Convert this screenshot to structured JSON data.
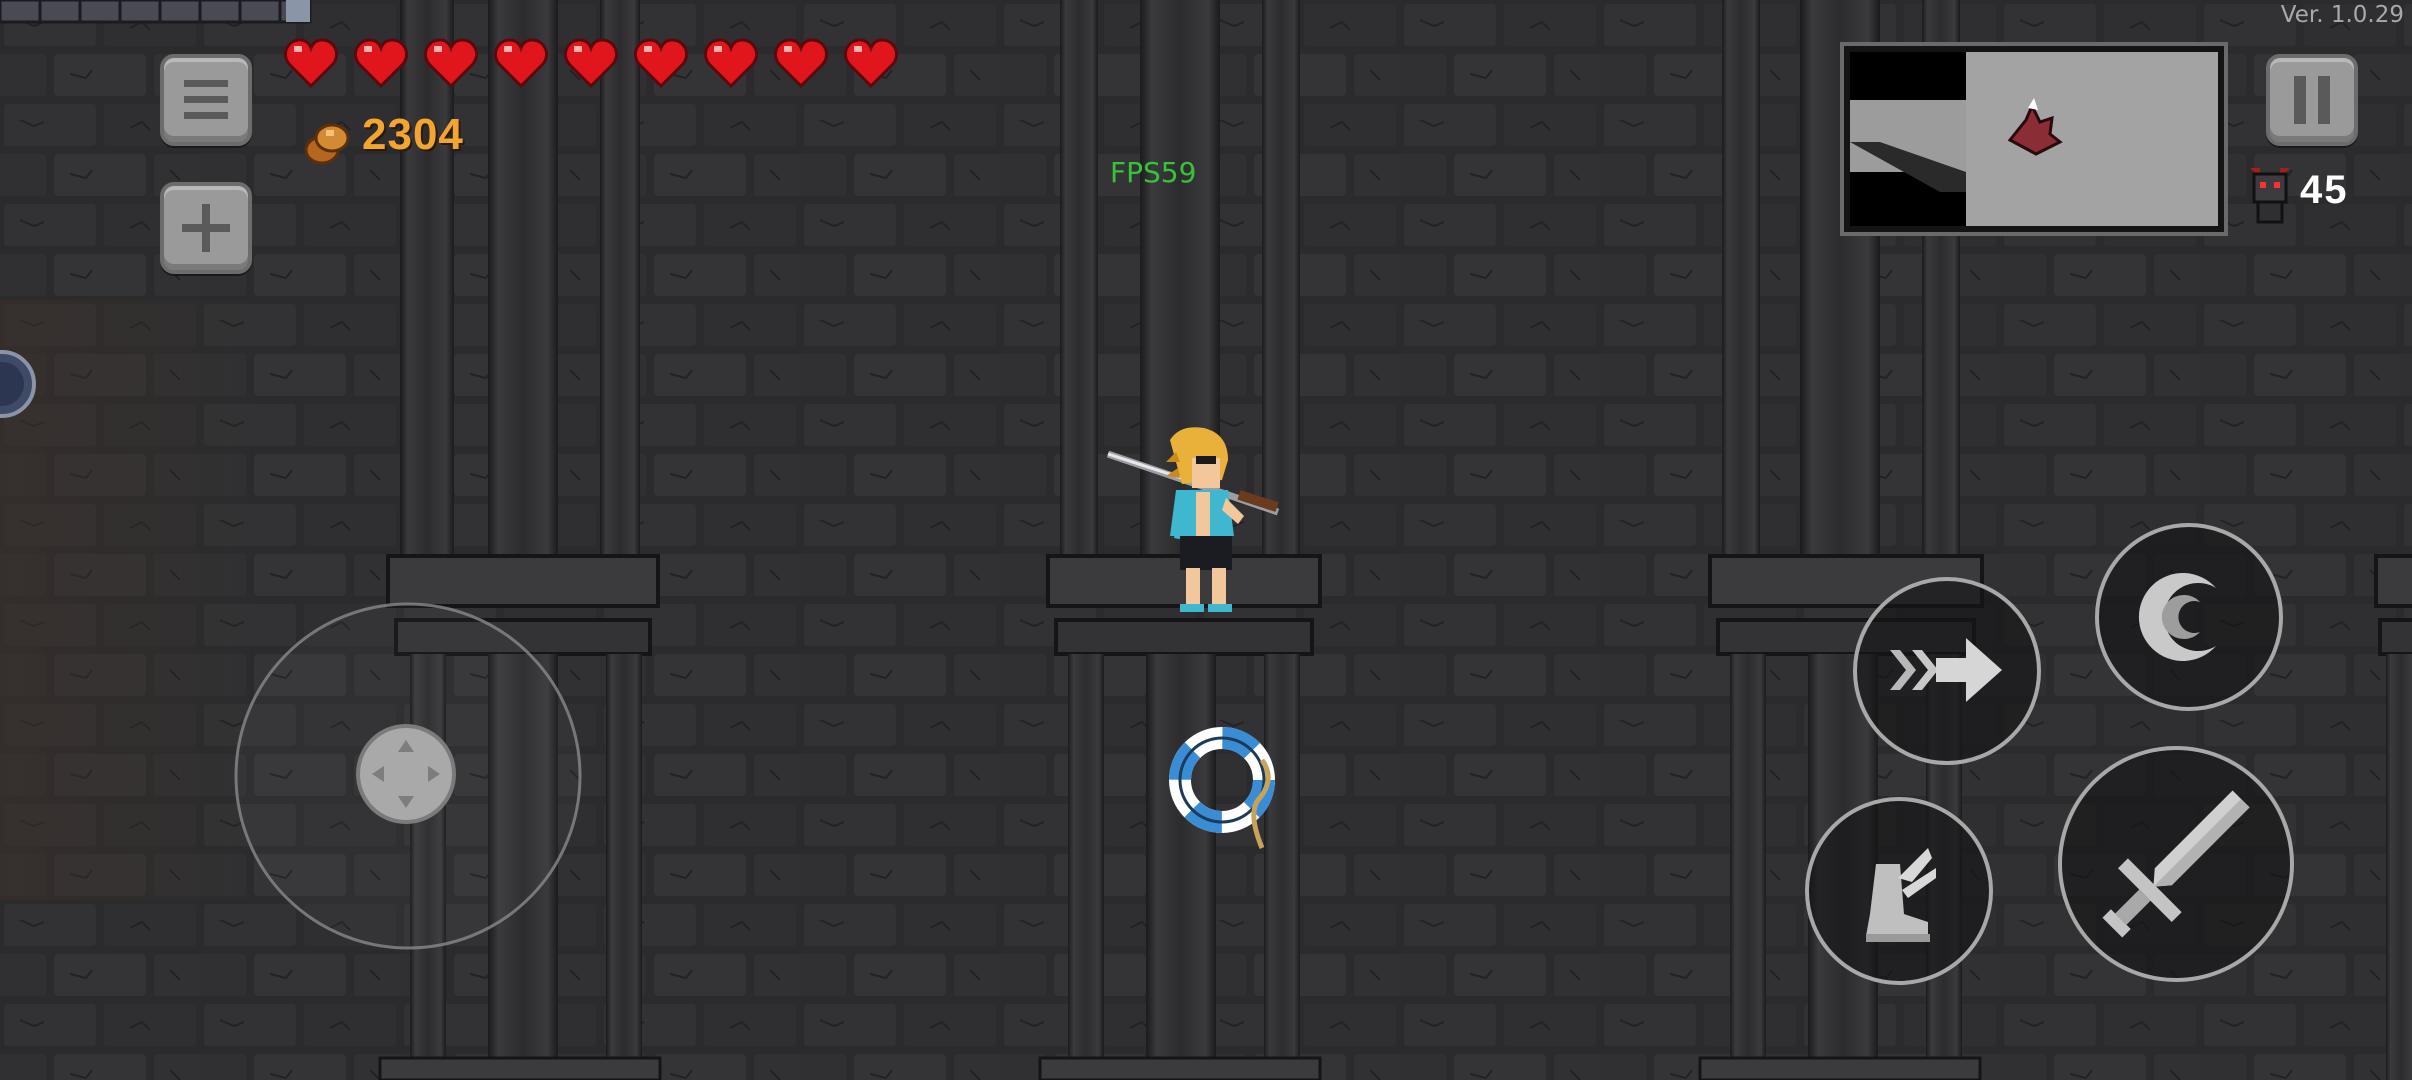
{
  "hud": {
    "version": "Ver. 1.0.29",
    "fps": "FPS59",
    "coins": "2304",
    "hearts": 9,
    "enemy_count": "45"
  },
  "colors": {
    "background": "#29292b",
    "heart": "#e0161c",
    "coin_text": "#f2a631",
    "fps_text": "#38c23a",
    "button_gray": "#9a9a9a"
  },
  "icons": {
    "menu": "menu-icon",
    "add": "plus-icon",
    "pause": "pause-icon",
    "dash": "dash-arrow-icon",
    "special": "crescent-moon-icon",
    "jump": "winged-boot-icon",
    "attack": "sword-icon",
    "coin": "coin-icon",
    "enemy": "demon-head-icon",
    "heart": "heart-icon"
  }
}
